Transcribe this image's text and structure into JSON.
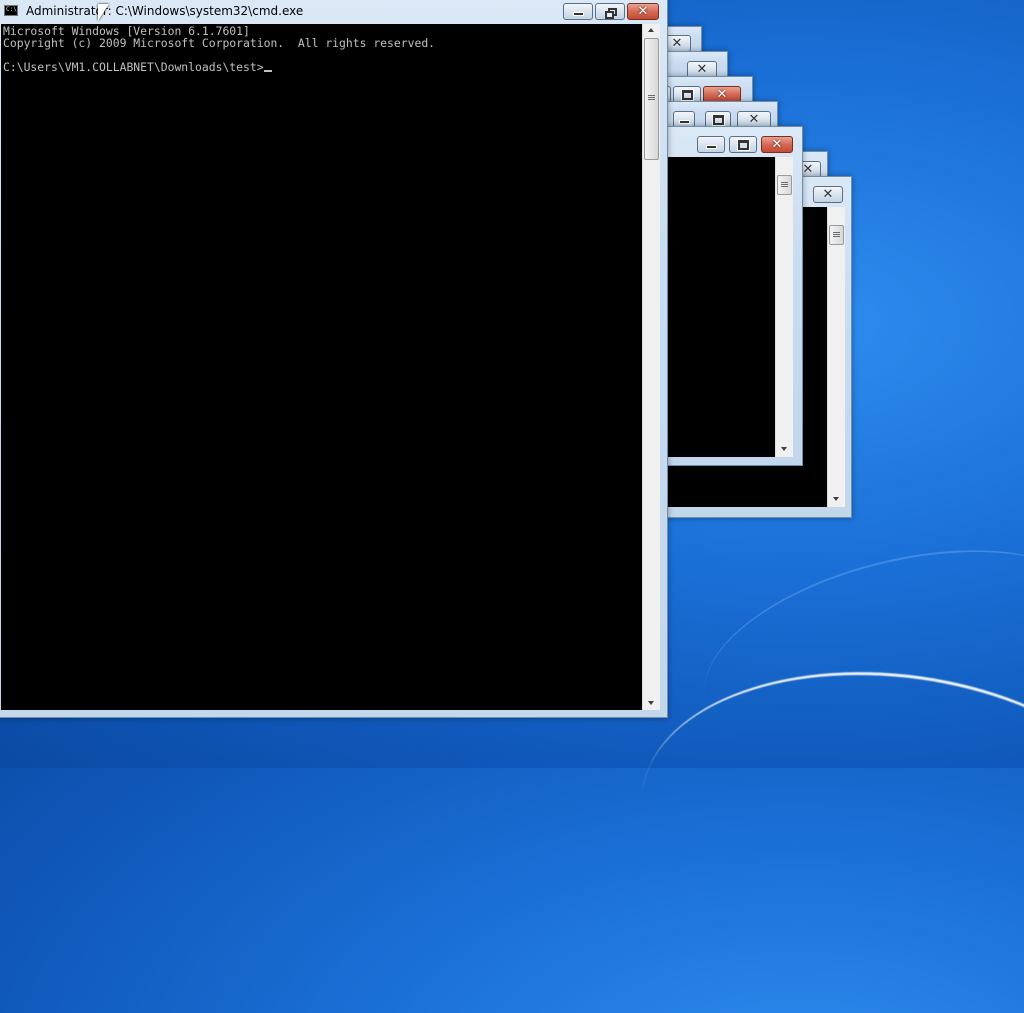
{
  "desktop": {
    "theme": "Windows 7 Aero",
    "accent": "#1a6fd6"
  },
  "main_window": {
    "title": "Administrator: C:\\Windows\\system32\\cmd.exe",
    "icon": "cmd-icon",
    "console_lines": [
      "Microsoft Windows [Version 6.1.7601]",
      "Copyright (c) 2009 Microsoft Corporation.  All rights reserved.",
      "",
      "C:\\Users\\VM1.COLLABNET\\Downloads\\test>"
    ],
    "controls": {
      "minimize": "minimize-icon",
      "restore": "restore-icon",
      "close": "close-icon"
    }
  },
  "background_windows_count": 7,
  "colors": {
    "console_bg": "#000000",
    "console_fg": "#c0c0c0",
    "close_button": "#c34b34"
  }
}
